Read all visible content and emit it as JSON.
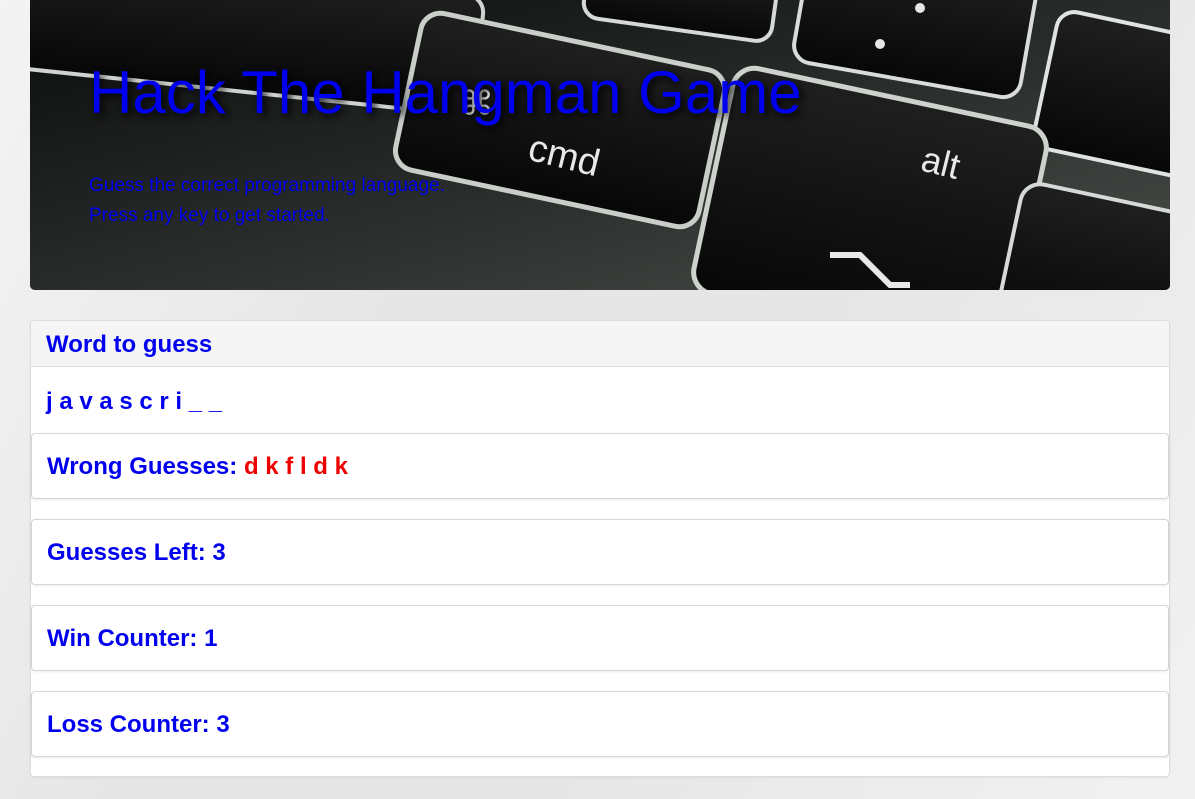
{
  "header": {
    "title": "Hack The Hangman Game",
    "line1": "Guess the correct programming language.",
    "line2": "Press any key to get started.",
    "background_key_labels": [
      "cmd",
      "alt"
    ]
  },
  "panel": {
    "heading": "Word to guess",
    "word": "j a v a s c r i _ _",
    "wrong_label": "Wrong Guesses:",
    "wrong_letters": "d k f l d k",
    "guesses_left_label": "Guesses Left:",
    "guesses_left": "3",
    "win_label": "Win Counter:",
    "win_count": "1",
    "loss_label": "Loss Counter:",
    "loss_count": "3"
  },
  "colors": {
    "text": "#0000ee",
    "wrong": "#ee0000",
    "heading_bg": "#f5f5f5",
    "page_bg": "#e6e6e6"
  }
}
